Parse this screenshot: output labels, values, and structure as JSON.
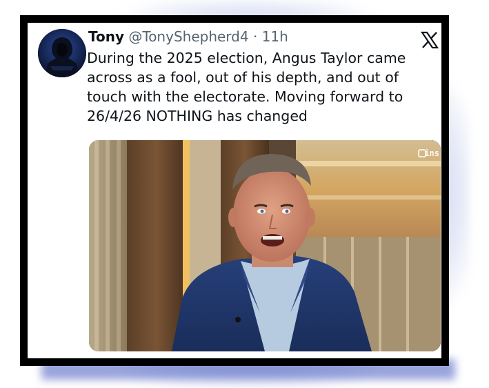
{
  "tweet": {
    "display_name": "Tony",
    "handle": "@TonyShepherd4",
    "separator": "·",
    "time": "11h",
    "text": "During the 2025 election, Angus Taylor came across as a fool, out of his depth, and out of touch with the electorate. Moving forward to 26/4/26 NOTHING has changed"
  },
  "media": {
    "watermark": "ins"
  },
  "icons": {
    "platform": "x-logo-icon",
    "broadcaster": "abc-logo-icon"
  },
  "colors": {
    "frame_glow": "#5a6ec8",
    "frame": "#000000",
    "text": "#0f1419",
    "meta_text": "#536471"
  }
}
